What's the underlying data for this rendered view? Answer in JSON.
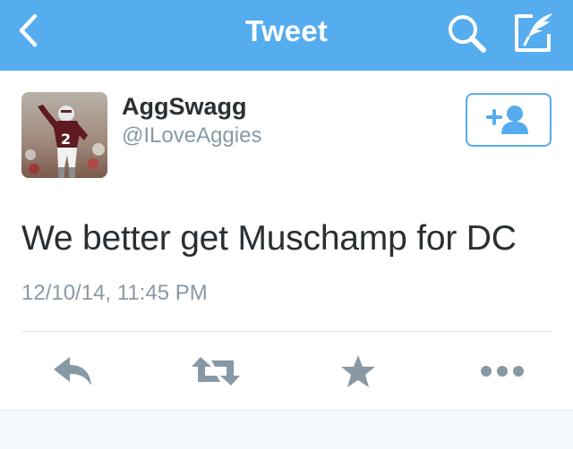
{
  "colors": {
    "brand": "#55acee",
    "text_primary": "#292f33",
    "text_secondary": "#8899a6",
    "action_icon": "#8899a6"
  },
  "navbar": {
    "title": "Tweet",
    "back_icon": "chevron-left-icon",
    "search_icon": "search-icon",
    "compose_icon": "compose-icon"
  },
  "tweet": {
    "author_name": "AggSwagg",
    "author_handle": "@ILoveAggies",
    "avatar_icon": "avatar",
    "follow_icon": "add-user-icon",
    "text": "We better get Muschamp for DC",
    "timestamp": "12/10/14, 11:45 PM"
  },
  "actions": [
    {
      "name": "reply",
      "icon": "reply-icon"
    },
    {
      "name": "retweet",
      "icon": "retweet-icon"
    },
    {
      "name": "favorite",
      "icon": "star-icon"
    },
    {
      "name": "more",
      "icon": "more-icon"
    }
  ]
}
